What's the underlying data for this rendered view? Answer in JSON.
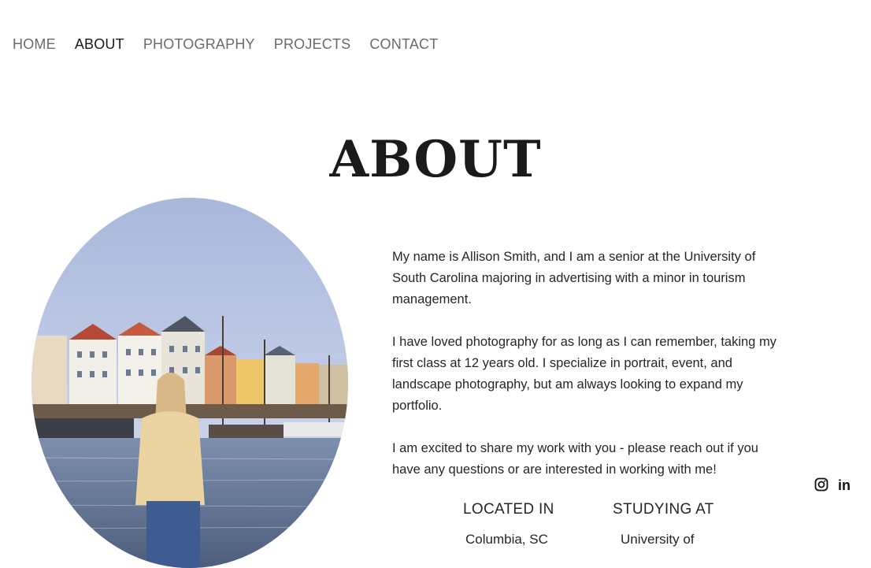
{
  "nav": {
    "items": [
      {
        "label": "HOME"
      },
      {
        "label": "ABOUT"
      },
      {
        "label": "PHOTOGRAPHY"
      },
      {
        "label": "PROJECTS"
      },
      {
        "label": "CONTACT"
      }
    ],
    "active": "ABOUT"
  },
  "page": {
    "title": "ABOUT"
  },
  "bio": {
    "p1": "My name is Allison Smith, and I am a senior at the University of South Carolina majoring in advertising with a minor in tourism management.",
    "p2": "I have loved photography for as long as I can remember, taking my first class at 12 years old. I specialize in portrait, event, and landscape photography, but am always looking to expand my portfolio.",
    "p3": "I am excited to share my work with you - please reach out if you have any questions or are interested in working with me!"
  },
  "facts": {
    "located_label": "LOCATED IN",
    "located_value": "Columbia, SC",
    "studying_label": "STUDYING AT",
    "studying_value": "University of"
  },
  "social": {
    "icons": [
      "instagram-icon",
      "linkedin-icon"
    ],
    "linkedin_glyph": "in"
  },
  "colors": {
    "text": "#1a1a1a",
    "nav_inactive": "#6b6b6b",
    "background": "#ffffff"
  }
}
